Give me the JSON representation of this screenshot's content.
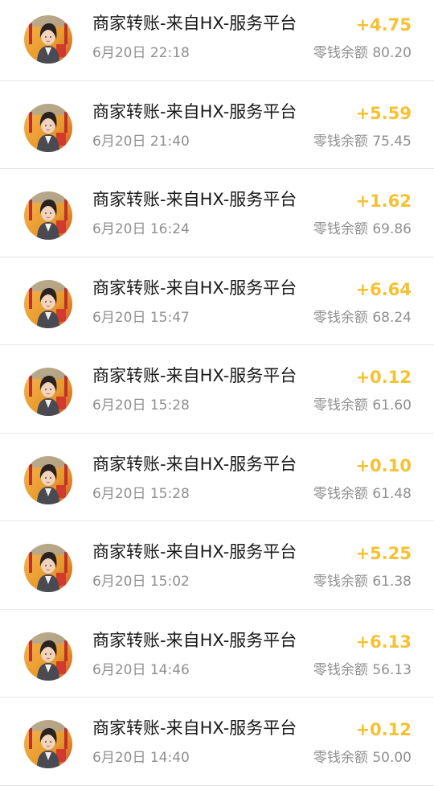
{
  "transactions": [
    {
      "title": "商家转账-来自HX-服务平台",
      "time": "6月20日 22:18",
      "amount": "+4.75",
      "balance": "零钱余额 80.20",
      "avatar_icon": "merchant-avatar-icon"
    },
    {
      "title": "商家转账-来自HX-服务平台",
      "time": "6月20日 21:40",
      "amount": "+5.59",
      "balance": "零钱余额 75.45",
      "avatar_icon": "merchant-avatar-icon"
    },
    {
      "title": "商家转账-来自HX-服务平台",
      "time": "6月20日 16:24",
      "amount": "+1.62",
      "balance": "零钱余额 69.86",
      "avatar_icon": "merchant-avatar-icon"
    },
    {
      "title": "商家转账-来自HX-服务平台",
      "time": "6月20日 15:47",
      "amount": "+6.64",
      "balance": "零钱余额 68.24",
      "avatar_icon": "merchant-avatar-icon"
    },
    {
      "title": "商家转账-来自HX-服务平台",
      "time": "6月20日 15:28",
      "amount": "+0.12",
      "balance": "零钱余额 61.60",
      "avatar_icon": "merchant-avatar-icon"
    },
    {
      "title": "商家转账-来自HX-服务平台",
      "time": "6月20日 15:28",
      "amount": "+0.10",
      "balance": "零钱余额 61.48",
      "avatar_icon": "merchant-avatar-icon"
    },
    {
      "title": "商家转账-来自HX-服务平台",
      "time": "6月20日 15:02",
      "amount": "+5.25",
      "balance": "零钱余额 61.38",
      "avatar_icon": "merchant-avatar-icon"
    },
    {
      "title": "商家转账-来自HX-服务平台",
      "time": "6月20日 14:46",
      "amount": "+6.13",
      "balance": "零钱余额 56.13",
      "avatar_icon": "merchant-avatar-icon"
    },
    {
      "title": "商家转账-来自HX-服务平台",
      "time": "6月20日 14:40",
      "amount": "+0.12",
      "balance": "零钱余额 50.00",
      "avatar_icon": "merchant-avatar-icon"
    }
  ],
  "colors": {
    "amount": "#f6c131",
    "title": "#1a1a1a",
    "secondary": "#8f8f8f",
    "divider": "#e6e6e6"
  }
}
